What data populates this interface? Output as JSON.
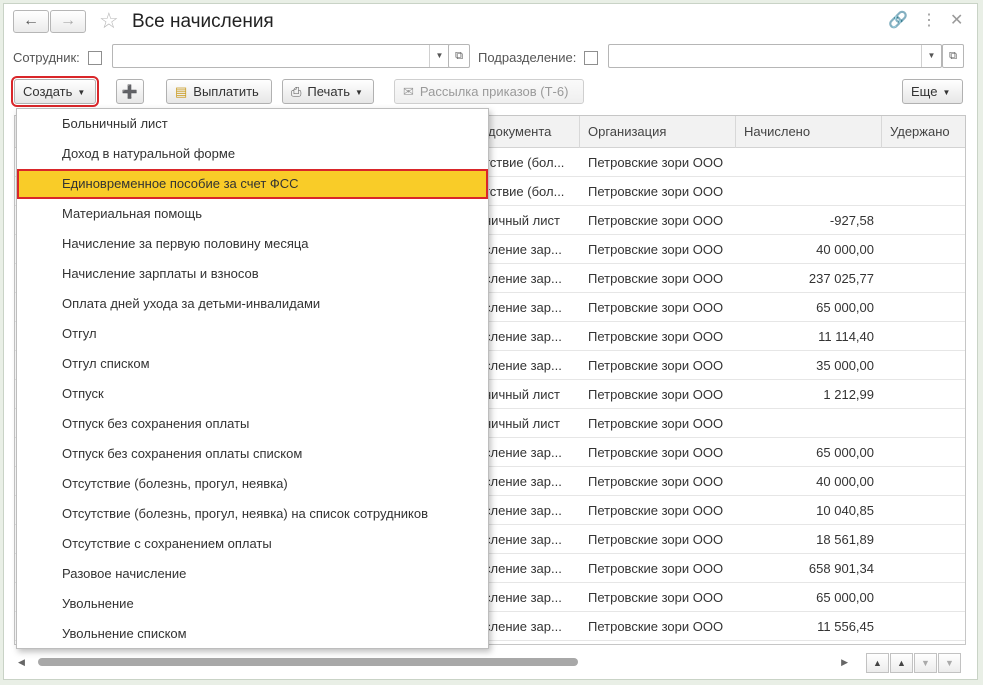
{
  "window": {
    "title": "Все начисления",
    "back_icon": "arrow-left-icon",
    "forward_icon": "arrow-right-icon",
    "favorite_icon": "star-icon"
  },
  "filters": {
    "employee_label": "Сотрудник:",
    "employee_value": "",
    "department_label": "Подразделение:",
    "department_value": ""
  },
  "toolbar": {
    "create_label": "Создать",
    "pay_label": "Выплатить",
    "print_label": "Печать",
    "mailing_label": "Рассылка приказов (Т-6)",
    "more_label": "Еще"
  },
  "table": {
    "columns": [
      "документа",
      "Организация",
      "Начислено",
      "Удержано"
    ],
    "rows": [
      {
        "doc": "тствие (бол...",
        "org": "Петровские зори ООО",
        "accrued": ""
      },
      {
        "doc": "тствие (бол...",
        "org": "Петровские зори ООО",
        "accrued": ""
      },
      {
        "doc": "ничный лист",
        "org": "Петровские зори ООО",
        "accrued": "-927,58"
      },
      {
        "doc": "сление зар...",
        "org": "Петровские зори ООО",
        "accrued": "40 000,00"
      },
      {
        "doc": "сление зар...",
        "org": "Петровские зори ООО",
        "accrued": "237 025,77"
      },
      {
        "doc": "сление зар...",
        "org": "Петровские зори ООО",
        "accrued": "65 000,00"
      },
      {
        "doc": "сление зар...",
        "org": "Петровские зори ООО",
        "accrued": "11 114,40"
      },
      {
        "doc": "сление зар...",
        "org": "Петровские зори ООО",
        "accrued": "35 000,00"
      },
      {
        "doc": "ничный лист",
        "org": "Петровские зори ООО",
        "accrued": "1 212,99"
      },
      {
        "doc": "ничный лист",
        "org": "Петровские зори ООО",
        "accrued": ""
      },
      {
        "doc": "сление зар...",
        "org": "Петровские зори ООО",
        "accrued": "65 000,00"
      },
      {
        "doc": "сление зар...",
        "org": "Петровские зори ООО",
        "accrued": "40 000,00"
      },
      {
        "doc": "сление зар...",
        "org": "Петровские зори ООО",
        "accrued": "10 040,85"
      },
      {
        "doc": "сление зар...",
        "org": "Петровские зори ООО",
        "accrued": "18 561,89"
      },
      {
        "doc": "сление зар...",
        "org": "Петровские зори ООО",
        "accrued": "658 901,34"
      },
      {
        "doc": "сление зар...",
        "org": "Петровские зори ООО",
        "accrued": "65 000,00"
      },
      {
        "doc": "сление зар...",
        "org": "Петровские зори ООО",
        "accrued": "11 556,45"
      }
    ]
  },
  "menu": {
    "items": [
      "Больничный лист",
      "Доход в натуральной форме",
      "Единовременное пособие за счет ФСС",
      "Материальная помощь",
      "Начисление за первую половину месяца",
      "Начисление зарплаты и взносов",
      "Оплата дней ухода за детьми-инвалидами",
      "Отгул",
      "Отгул списком",
      "Отпуск",
      "Отпуск без сохранения оплаты",
      "Отпуск без сохранения оплаты списком",
      "Отсутствие (болезнь, прогул, неявка)",
      "Отсутствие (болезнь, прогул, неявка) на список сотрудников",
      "Отсутствие с сохранением оплаты",
      "Разовое начисление",
      "Увольнение",
      "Увольнение списком"
    ],
    "highlighted_index": 2,
    "highlight_color": "#f9cc28",
    "accent_border_color": "#d9262a"
  }
}
